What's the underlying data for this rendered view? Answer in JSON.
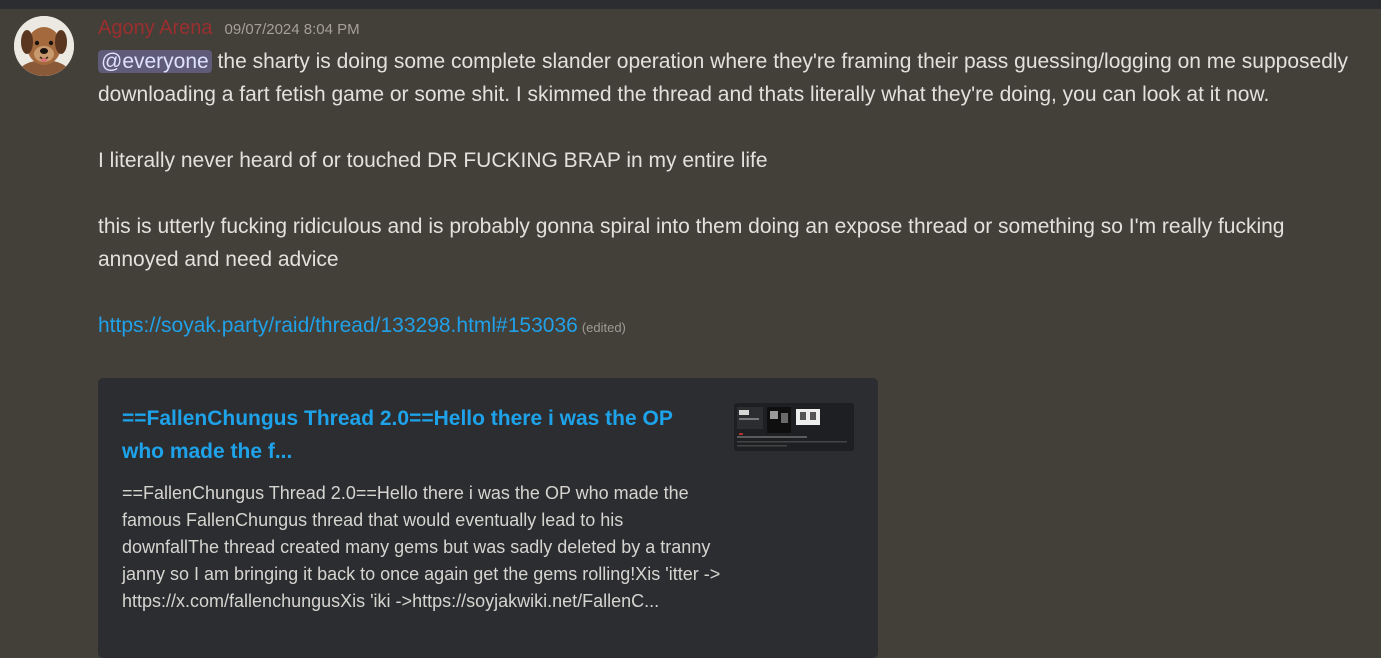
{
  "message": {
    "username": "Agony Arena",
    "timestamp": "09/07/2024 8:04 PM",
    "username_color": "#9b2f2f",
    "mention": "@everyone",
    "para1_rest": " the sharty is doing some complete slander operation where they're framing their pass guessing/logging on me supposedly downloading a fart fetish game or some shit. I skimmed the thread and thats literally what they're doing, you can look at it now.",
    "para2": "I literally never heard of or touched DR FUCKING BRAP in my entire life",
    "para3": "this is utterly fucking ridiculous and is probably gonna spiral into them doing an expose thread or something so I'm really fucking annoyed and need advice",
    "link": "https://soyak.party/raid/thread/133298.html#153036",
    "edited": "(edited)"
  },
  "embed": {
    "title": "==FallenChungus Thread 2.0==Hello there i was the OP who made the f...",
    "description": "==FallenChungus Thread 2.0==Hello there i was the OP who made the famous FallenChungus thread that would eventually lead to his downfallThe thread created many gems but was sadly deleted by a tranny janny so I am bringing it back to once again get the gems rolling!Xis 'itter -> https://x.com/fallenchungusXis 'iki ->https://soyjakwiki.net/FallenC..."
  }
}
